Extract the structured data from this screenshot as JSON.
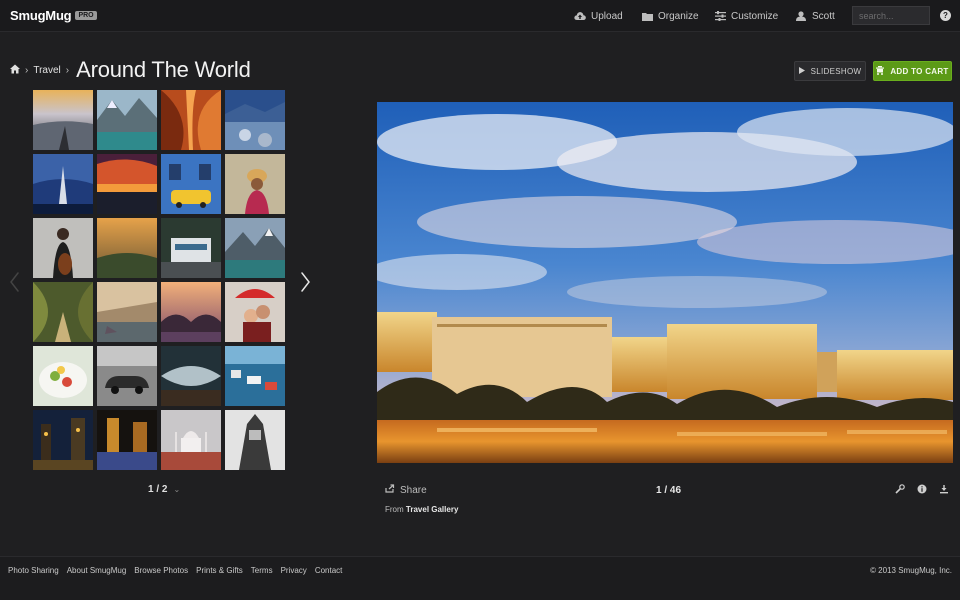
{
  "brand": {
    "name": "SmugMug",
    "badge": "PRO"
  },
  "nav": {
    "upload": "Upload",
    "organize": "Organize",
    "customize": "Customize",
    "user": "Scott"
  },
  "search": {
    "placeholder": "search..."
  },
  "help": {
    "label": "?"
  },
  "breadcrumb": {
    "parent": "Travel",
    "title": "Around The World"
  },
  "actions": {
    "slideshow": "SLIDESHOW",
    "add_to_cart": "ADD TO CART"
  },
  "thumbnails": {
    "pager": "1 / 2",
    "count": 24
  },
  "photo": {
    "share": "Share",
    "counter": "1 / 46",
    "from_prefix": "From",
    "from_gallery": "Travel Gallery"
  },
  "footer": {
    "links": [
      "Photo Sharing",
      "About SmugMug",
      "Browse Photos",
      "Prints & Gifts",
      "Terms",
      "Privacy",
      "Contact"
    ],
    "copyright": "© 2013 SmugMug, Inc."
  },
  "colors": {
    "background": "#1f1f21",
    "cart_button": "#5c9a17",
    "text": "#cfcfcf"
  }
}
